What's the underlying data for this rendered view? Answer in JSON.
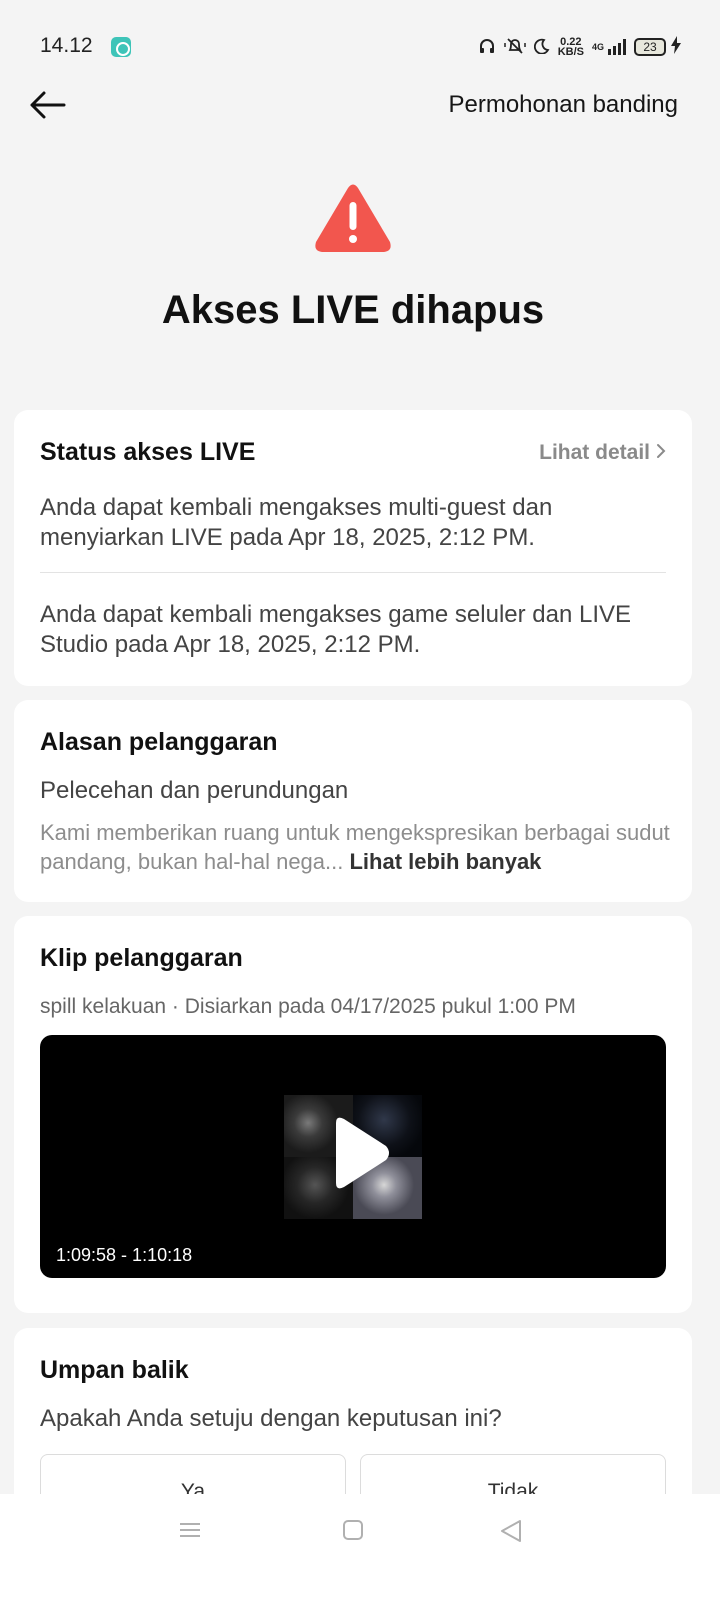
{
  "status_bar": {
    "time": "14.12",
    "speed_top": "0.22",
    "speed_bottom": "KB/S",
    "network": "4G",
    "battery": "23"
  },
  "header": {
    "appeal_label": "Permohonan banding"
  },
  "hero": {
    "title": "Akses LIVE dihapus",
    "icon_color": "#f2564e"
  },
  "status_card": {
    "title": "Status akses LIVE",
    "detail_label": "Lihat detail",
    "items": [
      "Anda dapat kembali mengakses multi-guest dan menyiarkan LIVE pada Apr 18, 2025, 2:12 PM.",
      "Anda dapat kembali mengakses game seluler dan LIVE Studio pada Apr 18, 2025, 2:12 PM."
    ]
  },
  "reason_card": {
    "title": "Alasan pelanggaran",
    "reason": "Pelecehan dan perundungan",
    "description": "Kami memberikan ruang untuk mengekspresikan berbagai sudut pandang, bukan hal-hal nega...",
    "see_more": "Lihat lebih banyak"
  },
  "clip_card": {
    "title": "Klip pelanggaran",
    "meta": "spill kelakuan · Disiarkan pada 04/17/2025 pukul 1:00 PM",
    "time_range": "1:09:58 - 1:10:18"
  },
  "feedback_card": {
    "title": "Umpan balik",
    "question": "Apakah Anda setuju dengan keputusan ini?",
    "yes_label": "Ya",
    "no_label": "Tidak"
  },
  "icons": {
    "back": "arrow-left-icon",
    "warning": "warning-triangle-icon",
    "play": "play-icon",
    "chevron": "chevron-right-icon"
  }
}
